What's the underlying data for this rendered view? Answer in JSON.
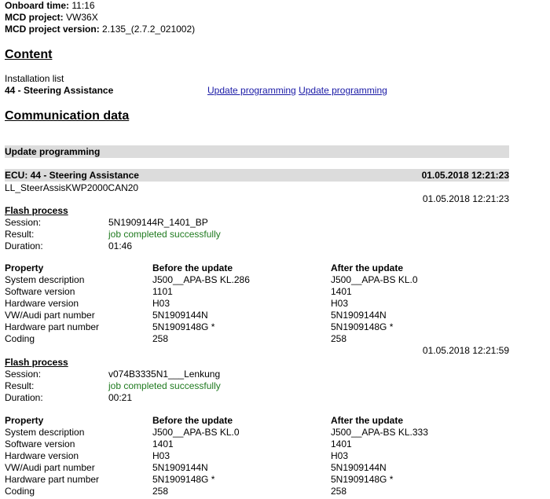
{
  "header": {
    "onboard_time_label": "Onboard time:",
    "onboard_time_value": "11:16",
    "mcd_project_label": "MCD project:",
    "mcd_project_value": "VW36X",
    "mcd_version_label": "MCD project version:",
    "mcd_version_value": "2.135_(2.7.2_021002)"
  },
  "content": {
    "heading": "Content",
    "installation_list_label": "Installation list",
    "item": "44 - Steering Assistance",
    "link1": "Update programming",
    "link2": "Update programming"
  },
  "comm": {
    "heading": "Communication data",
    "bar_title": "Update programming",
    "ecu_title": "ECU: 44 - Steering Assistance",
    "ecu_timestamp": "01.05.2018 12:21:23",
    "ecu_sub": "LL_SteerAssisKWP2000CAN20",
    "ts1": "01.05.2018 12:21:23",
    "ts2": "01.05.2018 12:21:59"
  },
  "labels": {
    "flash_process": "Flash process",
    "session": "Session:",
    "result": "Result:",
    "duration": "Duration:",
    "property": "Property",
    "before": "Before the update",
    "after": "After the update",
    "system_description": "System description",
    "software_version": "Software version",
    "hardware_version": "Hardware version",
    "vw_audi_part": "VW/Audi part number",
    "hw_part": "Hardware part number",
    "coding": "Coding"
  },
  "flash1": {
    "session": "5N1909144R_1401_BP",
    "result": "job completed successfully",
    "duration": "01:46",
    "before": [
      "J500__APA-BS KL.286",
      "1101",
      "H03",
      "5N1909144N",
      "5N1909148G *",
      "258"
    ],
    "after": [
      "J500__APA-BS KL.0",
      "1401",
      "H03",
      "5N1909144N",
      "5N1909148G *",
      "258"
    ]
  },
  "flash2": {
    "session": "v074B3335N1___Lenkung",
    "result": "job completed successfully",
    "duration": "00:21",
    "before": [
      "J500__APA-BS KL.0",
      "1401",
      "H03",
      "5N1909144N",
      "5N1909148G *",
      "258"
    ],
    "after": [
      "J500__APA-BS KL.333",
      "1401",
      "H03",
      "5N1909144N",
      "5N1909148G *",
      "258"
    ]
  }
}
